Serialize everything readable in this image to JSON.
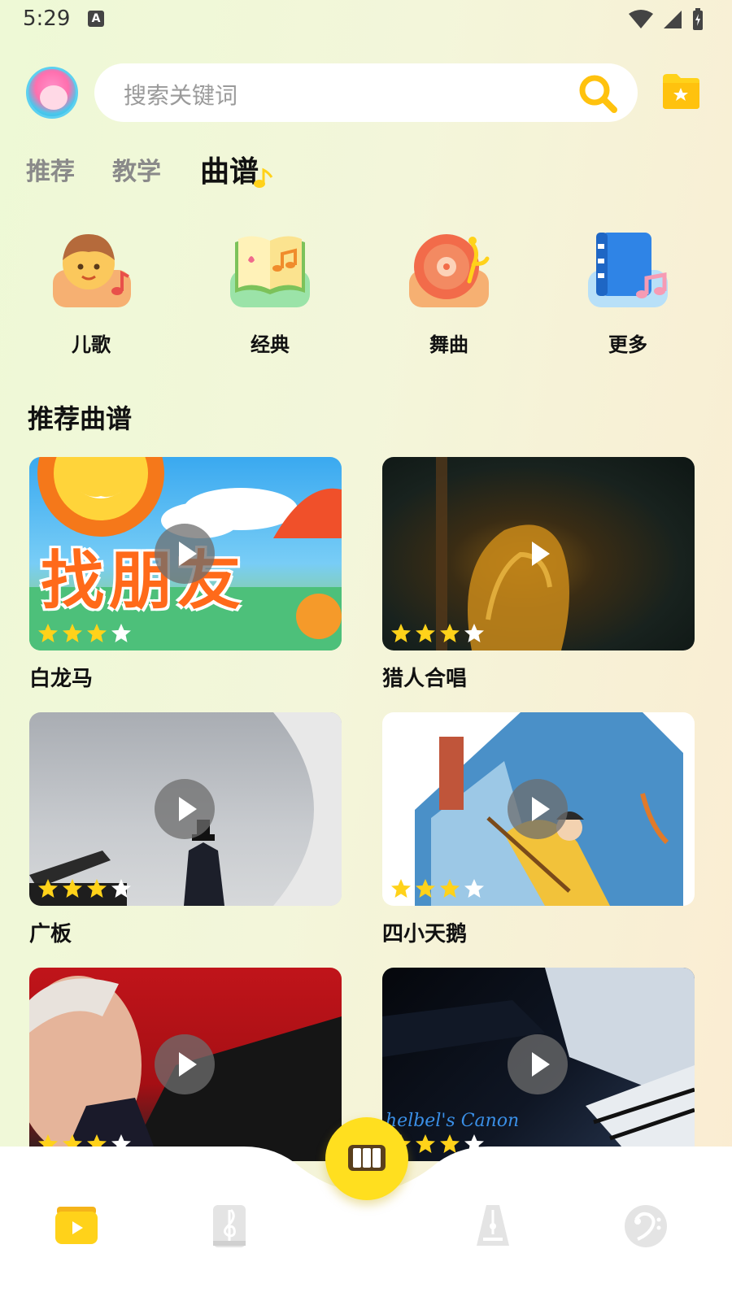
{
  "status_bar": {
    "time": "5:29",
    "notif_icon": "A"
  },
  "search": {
    "placeholder": "搜索关键词"
  },
  "tabs": [
    {
      "label": "推荐",
      "active": false
    },
    {
      "label": "教学",
      "active": false
    },
    {
      "label": "曲谱",
      "active": true
    }
  ],
  "categories": [
    {
      "label": "儿歌",
      "icon": "child-song-icon"
    },
    {
      "label": "经典",
      "icon": "classic-book-icon"
    },
    {
      "label": "舞曲",
      "icon": "dance-record-icon"
    },
    {
      "label": "更多",
      "icon": "more-book-icon"
    }
  ],
  "section": {
    "title": "推荐曲谱"
  },
  "cards": [
    {
      "title": "白龙马",
      "stars": 3,
      "max_stars": 4,
      "thumb_text": "找朋友"
    },
    {
      "title": "猎人合唱",
      "stars": 3,
      "max_stars": 4
    },
    {
      "title": "广板",
      "stars": 3,
      "max_stars": 4
    },
    {
      "title": "四小天鹅",
      "stars": 3,
      "max_stars": 4
    },
    {
      "title": "",
      "stars": 3,
      "max_stars": 4
    },
    {
      "title": "",
      "stars": 3,
      "max_stars": 4,
      "thumb_text": "helbel's Canon"
    }
  ],
  "bottom_nav": [
    {
      "icon": "video-icon",
      "active": true
    },
    {
      "icon": "treble-clef-icon",
      "active": false
    },
    {
      "icon": "piano-keys-icon",
      "active": false
    },
    {
      "icon": "metronome-icon",
      "active": false
    },
    {
      "icon": "bass-clef-icon",
      "active": false
    }
  ],
  "colors": {
    "accent": "#ffdf1f",
    "star": "#ffd21a",
    "inactive_icon": "#d7d7d7"
  }
}
